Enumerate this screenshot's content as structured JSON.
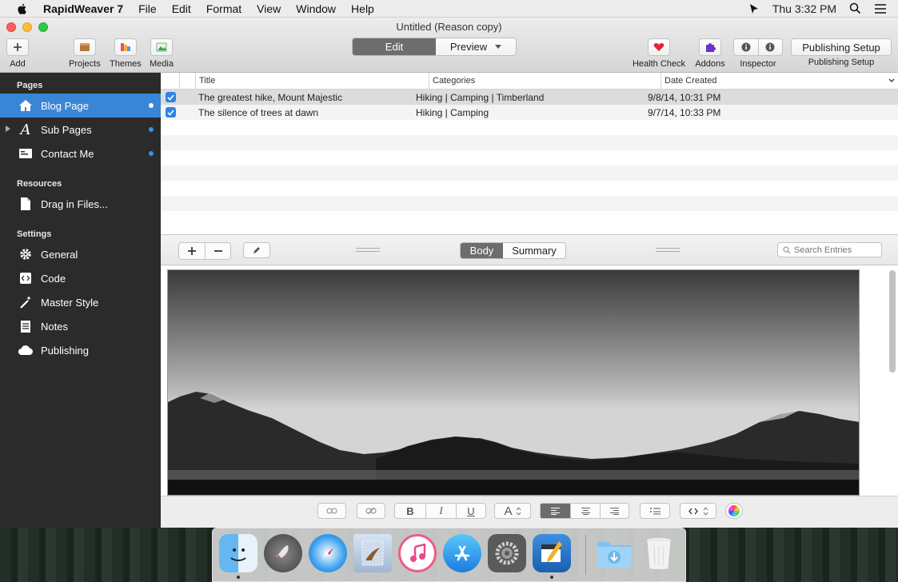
{
  "menubar": {
    "items": [
      "RapidWeaver 7",
      "File",
      "Edit",
      "Format",
      "View",
      "Window",
      "Help"
    ],
    "clock": "Thu 3:32 PM"
  },
  "window": {
    "title": "Untitled (Reason  copy)",
    "toolbar": {
      "add": "Add",
      "projects": "Projects",
      "themes": "Themes",
      "media": "Media",
      "edit": "Edit",
      "preview": "Preview",
      "health_check": "Health Check",
      "addons": "Addons",
      "inspector": "Inspector",
      "publishing_setup_button": "Publishing Setup",
      "publishing_setup_label": "Publishing Setup"
    }
  },
  "sidebar": {
    "pages_header": "Pages",
    "pages": [
      {
        "label": "Blog Page",
        "icon": "home-icon"
      },
      {
        "label": "Sub Pages",
        "icon": "font-a-icon"
      },
      {
        "label": "Contact Me",
        "icon": "contact-card-icon"
      }
    ],
    "resources_header": "Resources",
    "resources": [
      {
        "label": "Drag in Files...",
        "icon": "file-icon"
      }
    ],
    "settings_header": "Settings",
    "settings": [
      {
        "label": "General",
        "icon": "gear-icon"
      },
      {
        "label": "Code",
        "icon": "code-icon"
      },
      {
        "label": "Master Style",
        "icon": "magic-wand-icon"
      },
      {
        "label": "Notes",
        "icon": "notes-icon"
      },
      {
        "label": "Publishing",
        "icon": "cloud-icon"
      }
    ]
  },
  "table": {
    "headers": [
      "Title",
      "Categories",
      "Date Created"
    ],
    "rows": [
      {
        "title": "The greatest hike, Mount Majestic",
        "categories": "Hiking | Camping | Timberland",
        "date": "9/8/14, 10:31 PM",
        "checked": true
      },
      {
        "title": "The silence of trees at dawn",
        "categories": "Hiking | Camping",
        "date": "9/7/14, 10:33 PM",
        "checked": true
      }
    ]
  },
  "midbar": {
    "body": "Body",
    "summary": "Summary",
    "search_placeholder": "Search Entries"
  },
  "formatbar": {
    "bold": "B",
    "italic": "I",
    "underline": "U",
    "font": "A"
  },
  "colors": {
    "sidebar_bg": "#2b2b2b",
    "selection": "#3a86d6",
    "segment_active": "#6d6d6d"
  }
}
